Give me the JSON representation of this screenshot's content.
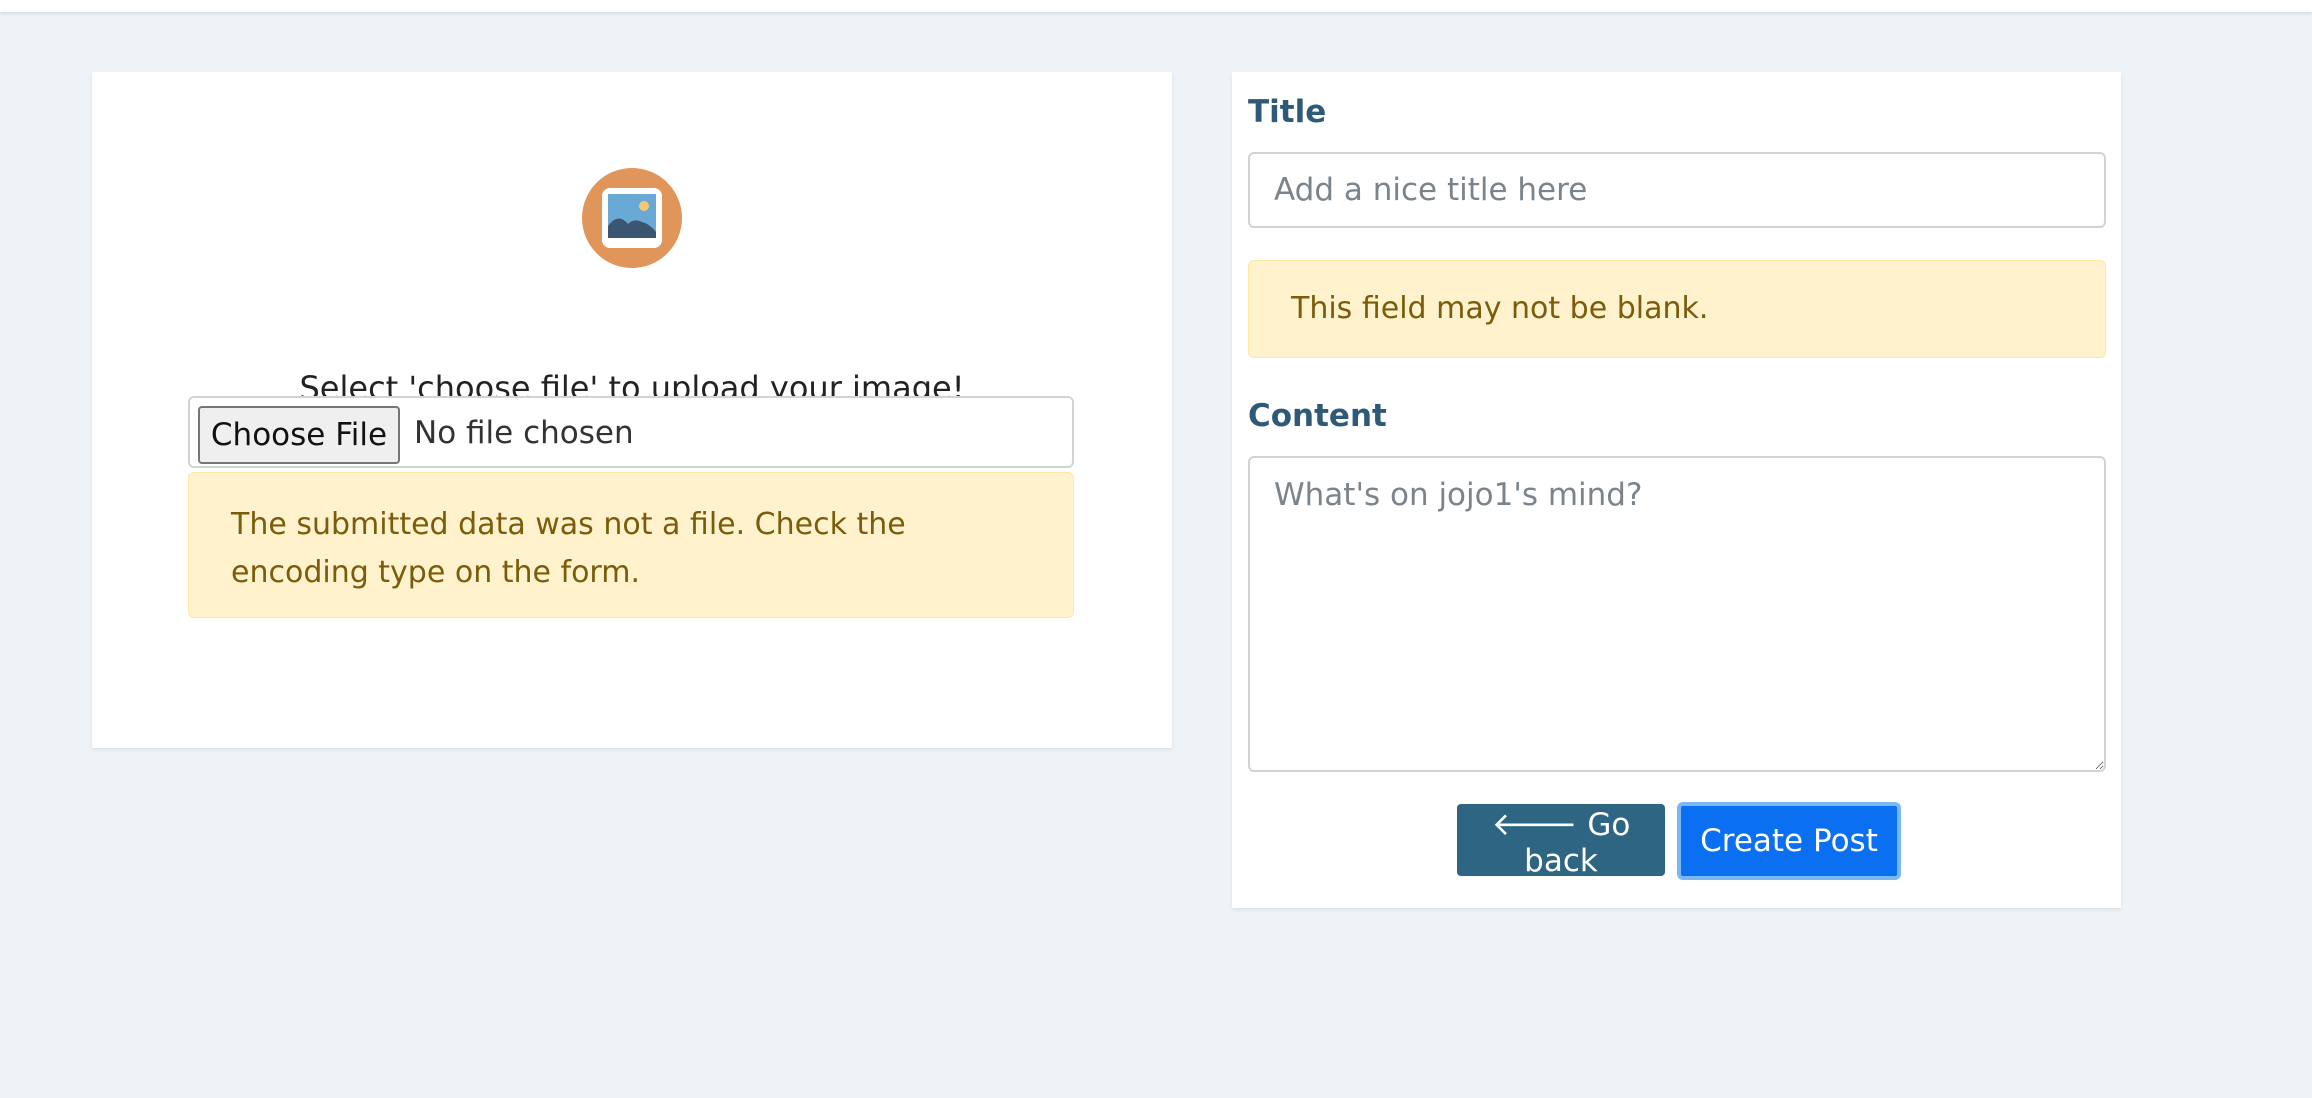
{
  "upload": {
    "instruction": "Select 'choose file' to upload your image!",
    "choose_button_label": "Choose File",
    "no_file_text": "No file chosen",
    "error_message": "The submitted data was not a file. Check the encoding type on the form.",
    "icon": "image-icon"
  },
  "post_form": {
    "title_label": "Title",
    "title_placeholder": "Add a nice title here",
    "title_value": "",
    "title_error": "This field may not be blank.",
    "content_label": "Content",
    "content_placeholder": "What's on jojo1's mind?",
    "content_value": "",
    "back_icon": "arrow-left-icon",
    "back_button_label": "Go back",
    "create_button_label": "Create Post"
  },
  "colors": {
    "background": "#eef3f7",
    "heading": "#2e5a78",
    "alert_background": "#fff2cc",
    "alert_text": "#7a5c0a",
    "back_button": "#2e6582",
    "primary_button": "#0a6ff0",
    "icon_circle": "#e0955a"
  }
}
